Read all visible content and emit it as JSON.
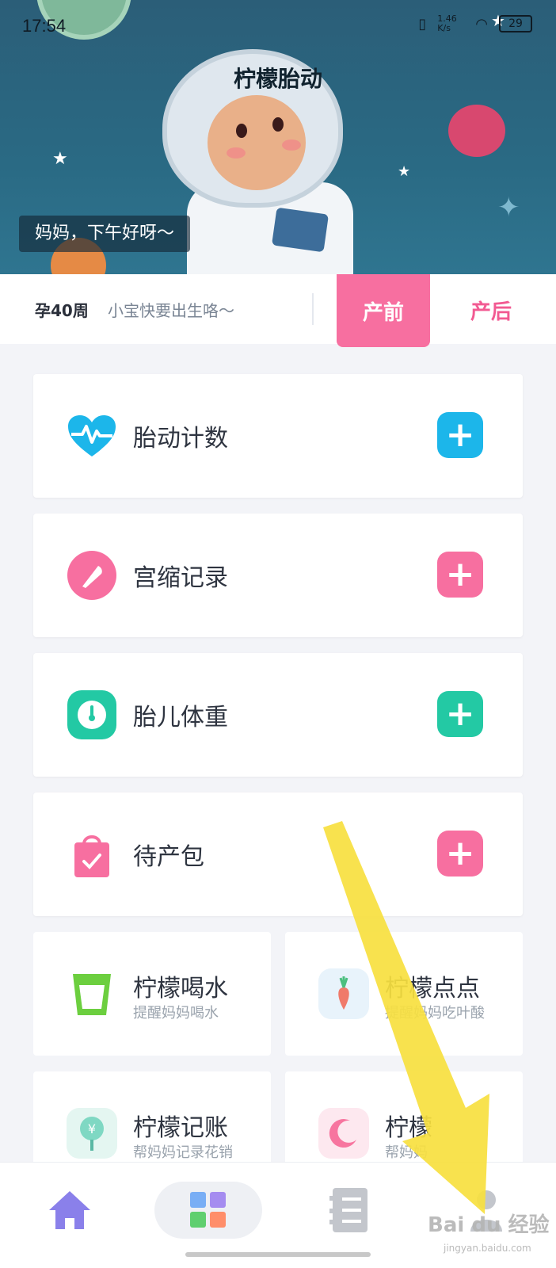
{
  "status_bar": {
    "time": "17:54",
    "net_speed": "1.46 K/s",
    "battery": "29"
  },
  "hero": {
    "title": "柠檬胎动",
    "greeting": "妈妈，下午好呀～"
  },
  "stage": {
    "week": "孕40周",
    "hint": "小宝快要出生咯～",
    "tab_pre": "产前",
    "tab_post": "产后"
  },
  "cards": [
    {
      "label": "胎动计数",
      "icon": "heartbeat-icon",
      "color": "#1cb6ea"
    },
    {
      "label": "宫缩记录",
      "icon": "timer-icon",
      "color": "#f76fa0"
    },
    {
      "label": "胎儿体重",
      "icon": "scale-icon",
      "color": "#23c9a4"
    },
    {
      "label": "待产包",
      "icon": "bag-icon",
      "color": "#f76fa0"
    }
  ],
  "tiles": [
    {
      "title": "柠檬喝水",
      "sub": "提醒妈妈喝水",
      "icon": "cup-icon"
    },
    {
      "title": "柠檬点点",
      "sub": "提醒妈妈吃叶酸",
      "icon": "carrot-icon"
    },
    {
      "title": "柠檬记账",
      "sub": "帮妈妈记录花销",
      "icon": "money-tree-icon"
    },
    {
      "title": "柠檬",
      "sub": "帮妈妈",
      "icon": "moon-icon"
    }
  ],
  "bottom_nav": [
    "home-icon",
    "grid-icon",
    "list-icon",
    "profile-icon"
  ],
  "watermark": {
    "main": "Bai du 经验",
    "sub": "jingyan.baidu.com"
  }
}
